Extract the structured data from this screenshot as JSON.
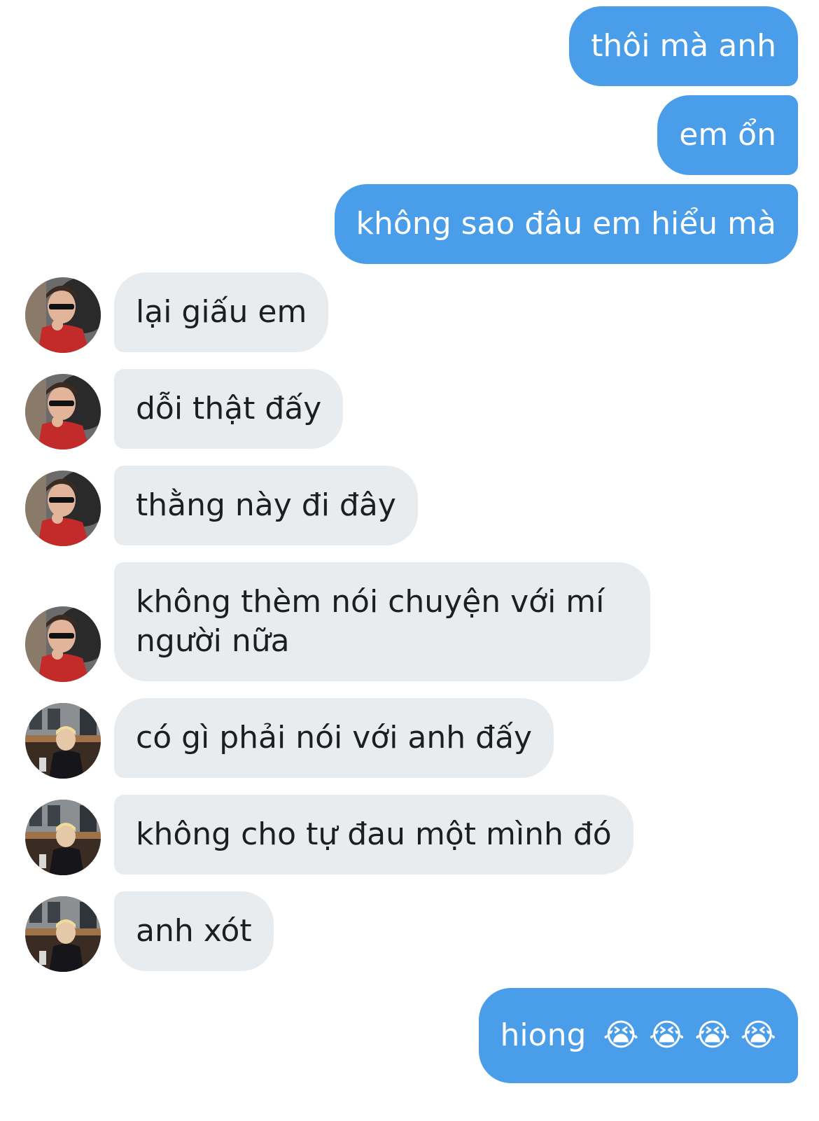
{
  "conversation": {
    "messages": [
      {
        "id": "m1",
        "from": "me",
        "text": "thôi mà anh"
      },
      {
        "id": "m2",
        "from": "me",
        "text": "em ổn"
      },
      {
        "id": "m3",
        "from": "me",
        "text": "không sao đâu em hiểu mà"
      },
      {
        "id": "m4",
        "from": "friend1",
        "text": "lại giấu em"
      },
      {
        "id": "m5",
        "from": "friend1",
        "text": "dỗi thật đấy"
      },
      {
        "id": "m6",
        "from": "friend1",
        "text": "thằng này đi đây"
      },
      {
        "id": "m7",
        "from": "friend1",
        "text": "không thèm nói chuyện với mí người nữa"
      },
      {
        "id": "m8",
        "from": "friend2",
        "text": "có gì phải nói với anh đấy"
      },
      {
        "id": "m9",
        "from": "friend2",
        "text": "không cho tự đau một mình đó"
      },
      {
        "id": "m10",
        "from": "friend2",
        "text": "anh xót"
      },
      {
        "id": "m11",
        "from": "me",
        "text": "hiong",
        "emoji": "😭 😭 😭 😭"
      }
    ]
  },
  "colors": {
    "sent_bubble": "#4a9de9",
    "received_bubble": "#e9ecef",
    "background": "#ffffff"
  },
  "icons": {
    "avatar_friend1": "avatar-red-shirt-sunglasses",
    "avatar_friend2": "avatar-blond-street"
  }
}
